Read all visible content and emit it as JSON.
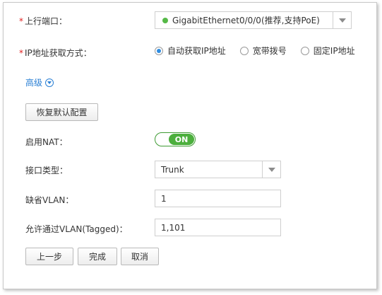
{
  "uplink": {
    "label": "上行端口：",
    "required_mark": "*",
    "selected": "GigabitEthernet0/0/0(推荐,支持PoE)",
    "status_color": "#56b947"
  },
  "ip_mode": {
    "label": "IP地址获取方式：",
    "required_mark": "*",
    "options": [
      "自动获取IP地址",
      "宽带拨号",
      "固定IP地址"
    ],
    "selected_index": 0
  },
  "advanced": {
    "label": "高级"
  },
  "restore_button": "恢复默认配置",
  "nat": {
    "label": "启用NAT：",
    "state": "ON"
  },
  "port_type": {
    "label": "接口类型：",
    "selected": "Trunk"
  },
  "default_vlan": {
    "label": "缺省VLAN：",
    "value": "1"
  },
  "allowed_vlan": {
    "label": "允许通过VLAN(Tagged)：",
    "value": "1,101"
  },
  "footer": {
    "prev": "上一步",
    "finish": "完成",
    "cancel": "取消"
  }
}
